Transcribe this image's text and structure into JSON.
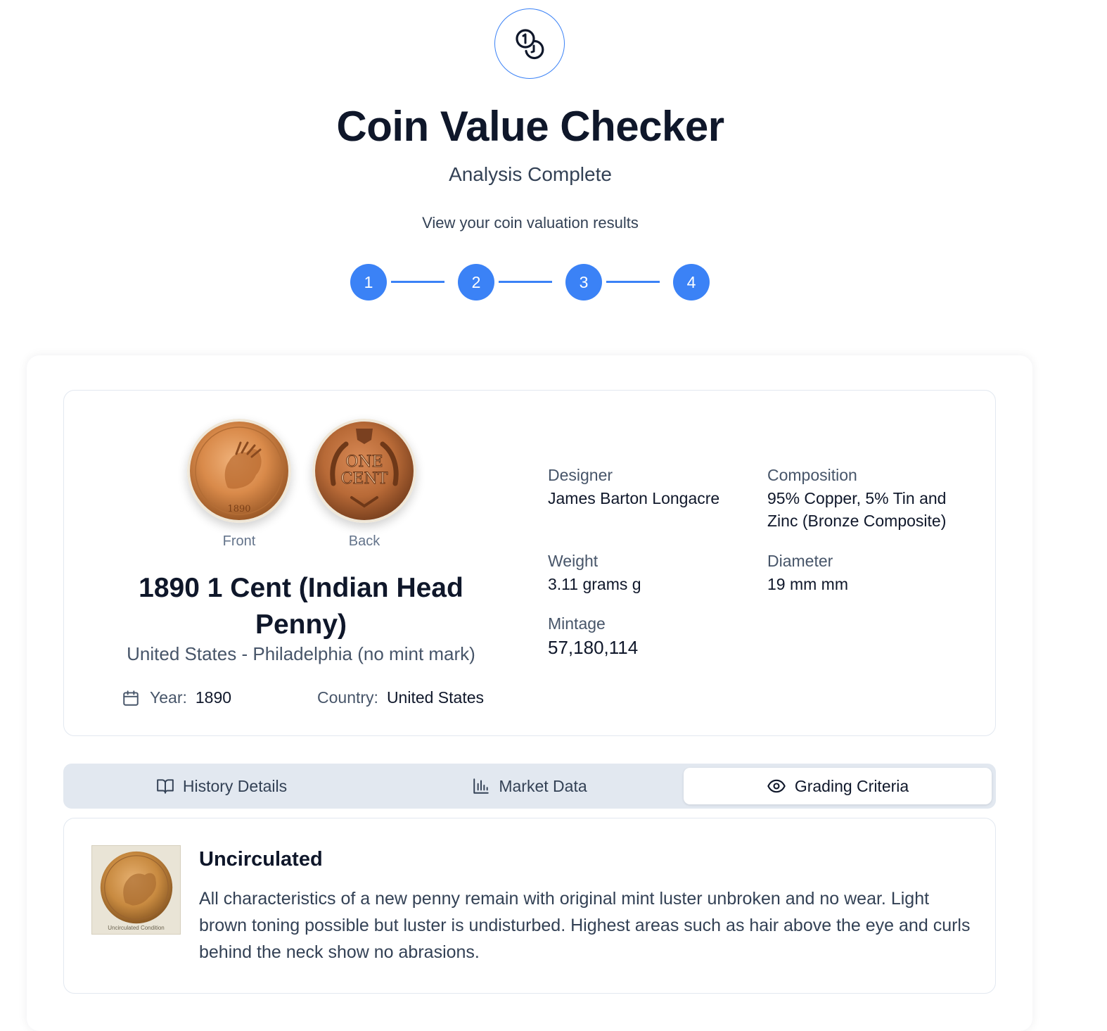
{
  "header": {
    "logo_icon": "coins-icon",
    "title": "Coin Value Checker",
    "subtitle": "Analysis Complete",
    "description": "View your coin valuation results"
  },
  "stepper": {
    "steps": [
      "1",
      "2",
      "3",
      "4"
    ],
    "color": "#3b82f6"
  },
  "coin": {
    "front_caption": "Front",
    "back_caption": "Back",
    "back_text_line1": "ONE",
    "back_text_line2": "CENT",
    "front_date": "1890",
    "name": "1890 1 Cent (Indian Head Penny)",
    "origin": "United States - Philadelphia (no mint mark)",
    "year_label": "Year:",
    "year_value": "1890",
    "country_label": "Country:",
    "country_value": "United States"
  },
  "specs": {
    "designer_label": "Designer",
    "designer_value": "James Barton Longacre",
    "composition_label": "Composition",
    "composition_value": "95% Copper, 5% Tin and Zinc (Bronze Composite)",
    "weight_label": "Weight",
    "weight_value": "3.11 grams g",
    "diameter_label": "Diameter",
    "diameter_value": "19 mm mm",
    "mintage_label": "Mintage",
    "mintage_value": "57,180,114"
  },
  "tabs": [
    {
      "label": "History Details",
      "icon": "book-open-icon",
      "active": false
    },
    {
      "label": "Market Data",
      "icon": "bar-chart-icon",
      "active": false
    },
    {
      "label": "Grading Criteria",
      "icon": "eye-icon",
      "active": true
    }
  ],
  "grading": {
    "title": "Uncirculated",
    "text": "All characteristics of a new penny remain with original mint luster unbroken and no wear. Light brown toning possible but luster is undisturbed. Highest areas such as hair above the eye and curls behind the neck show no abrasions.",
    "thumb_caption": "Uncirculated Condition"
  }
}
